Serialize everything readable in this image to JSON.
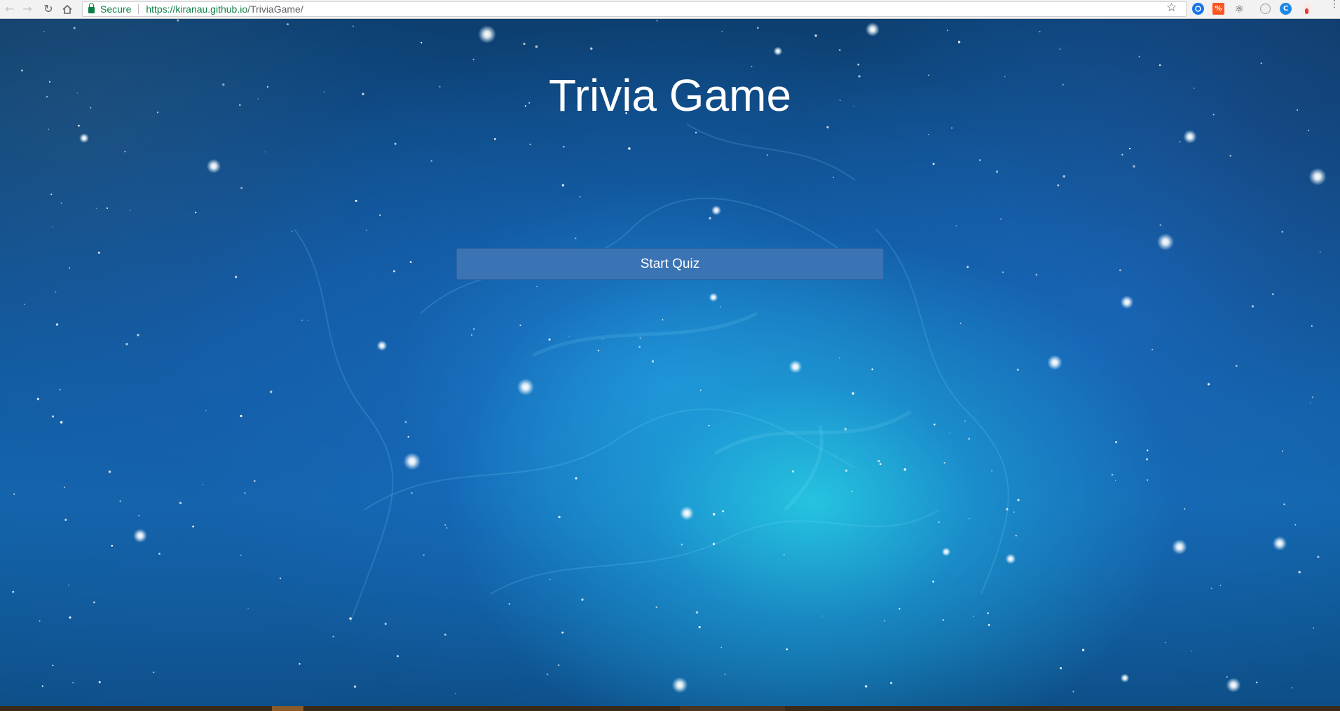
{
  "browser": {
    "back_icon": "back-arrow-icon",
    "forward_icon": "forward-arrow-icon",
    "reload_icon": "reload-icon",
    "home_icon": "home-icon",
    "secure_label": "Secure",
    "url_host": "https://kiranau.github.io",
    "url_path": "/TriviaGame/",
    "bookmark_icon": "star-icon",
    "extensions": [
      {
        "name": "extension-blue-icon",
        "color": "#1a73e8"
      },
      {
        "name": "extension-orange-icon",
        "color": "#ff5722"
      },
      {
        "name": "react-devtools-icon",
        "color": "#444444"
      },
      {
        "name": "extension-white-circle-icon",
        "color": "#9e9e9e"
      },
      {
        "name": "extension-blue-c-icon",
        "color": "#1e88e5"
      },
      {
        "name": "extension-red-icon",
        "color": "#e53935"
      }
    ],
    "menu_icon": "more-vertical-icon"
  },
  "page": {
    "title": "Trivia Game",
    "start_button_label": "Start Quiz",
    "colors": {
      "button_bg": "#3a74b4",
      "title_text": "#ffffff"
    }
  }
}
